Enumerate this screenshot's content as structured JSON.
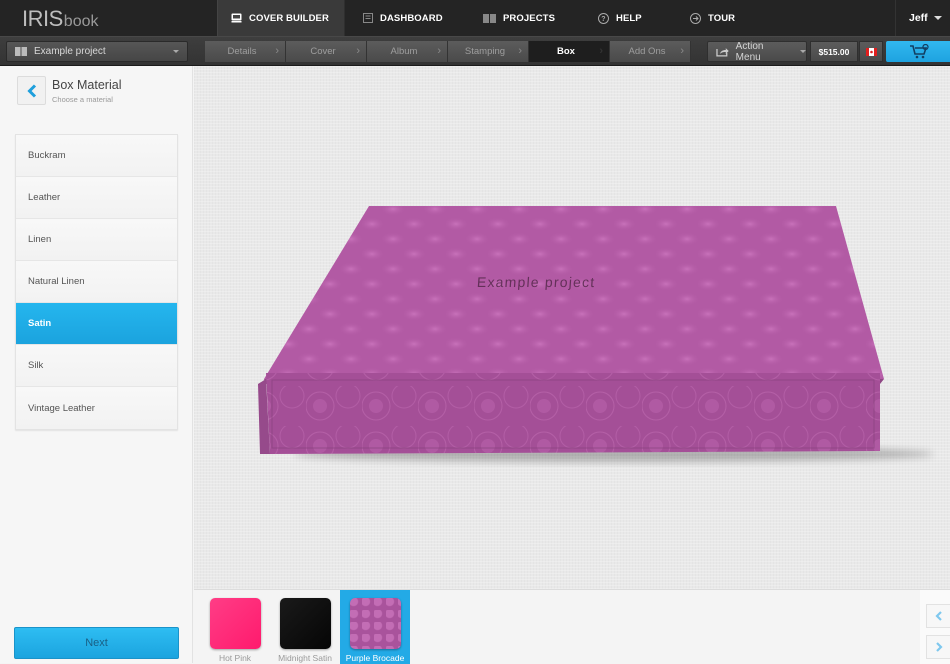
{
  "app": {
    "logo_main": "IRIS",
    "logo_sub": "book"
  },
  "topnav": [
    {
      "label": "COVER BUILDER",
      "icon": "cover-icon",
      "active": true
    },
    {
      "label": "DASHBOARD",
      "icon": "dashboard-icon",
      "active": false
    },
    {
      "label": "PROJECTS",
      "icon": "projects-icon",
      "active": false
    },
    {
      "label": "HELP",
      "icon": "help-icon",
      "active": false
    },
    {
      "label": "TOUR",
      "icon": "tour-icon",
      "active": false
    }
  ],
  "user": {
    "name": "Jeff"
  },
  "project_select": {
    "value": "Example project"
  },
  "steps": [
    {
      "label": "Details"
    },
    {
      "label": "Cover"
    },
    {
      "label": "Album"
    },
    {
      "label": "Stamping"
    },
    {
      "label": "Box",
      "active": true
    },
    {
      "label": "Add Ons"
    }
  ],
  "action_menu": {
    "label": "Action Menu"
  },
  "price": "$515.00",
  "currency_flag": "canada-flag",
  "sidebar": {
    "title": "Box Material",
    "subtitle": "Choose a material",
    "materials": [
      "Buckram",
      "Leather",
      "Linen",
      "Natural Linen",
      "Satin",
      "Silk",
      "Vintage Leather"
    ],
    "selected": "Satin",
    "next_label": "Next"
  },
  "preview": {
    "title_stamp": "Example project",
    "box_color": "#b25aa4"
  },
  "swatches": [
    {
      "label": "Hot Pink",
      "color": "#ff2a7a"
    },
    {
      "label": "Midnight Satin",
      "color": "#0c0c0c"
    },
    {
      "label": "Purple Brocade",
      "color": "#a9539c",
      "selected": true
    }
  ],
  "colors": {
    "accent": "#23aae6",
    "topbar": "#242424"
  }
}
